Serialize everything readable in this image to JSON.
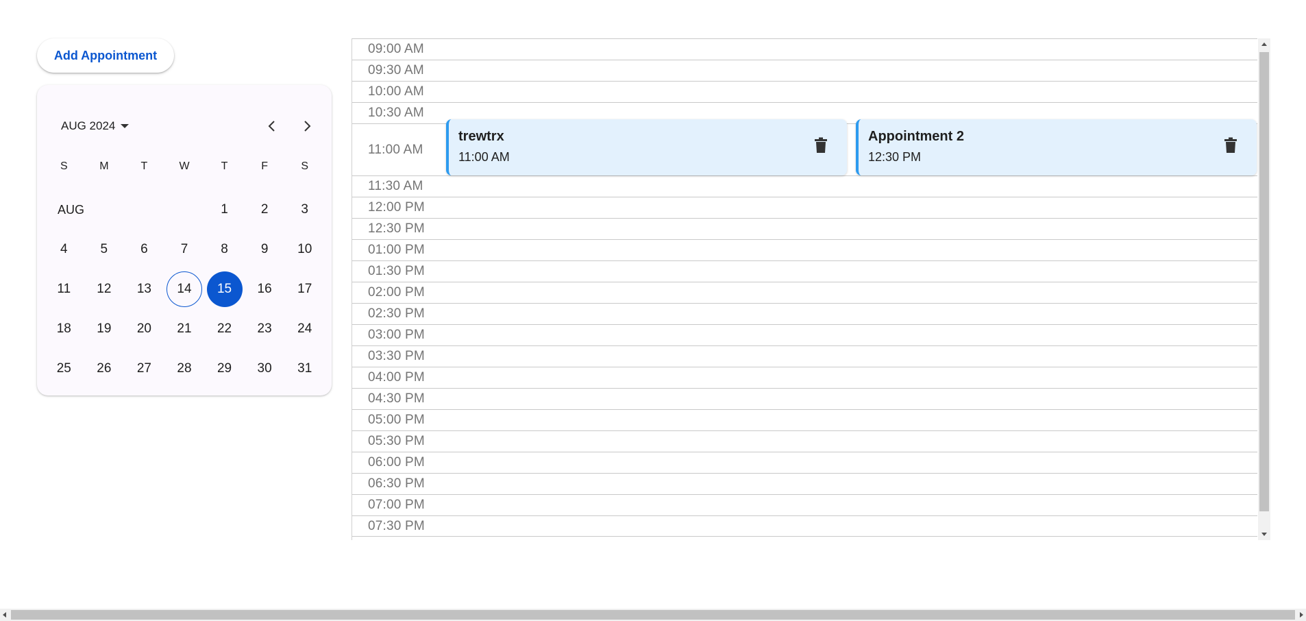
{
  "toolbar": {
    "add_label": "Add Appointment"
  },
  "calendar": {
    "month_label": "AUG 2024",
    "weekdays": [
      "S",
      "M",
      "T",
      "W",
      "T",
      "F",
      "S"
    ],
    "row_month_label": "AUG",
    "first_weekday_index": 4,
    "days_in_month": 31,
    "today": 14,
    "selected": 15,
    "icons": {
      "dropdown": "caret-down-icon",
      "prev": "chevron-left-icon",
      "next": "chevron-right-icon"
    }
  },
  "schedule": {
    "time_slots": [
      "09:00 AM",
      "09:30 AM",
      "10:00 AM",
      "10:30 AM",
      "11:00 AM",
      "11:30 AM",
      "12:00 PM",
      "12:30 PM",
      "01:00 PM",
      "01:30 PM",
      "02:00 PM",
      "02:30 PM",
      "03:00 PM",
      "03:30 PM",
      "04:00 PM",
      "04:30 PM",
      "05:00 PM",
      "05:30 PM",
      "06:00 PM",
      "06:30 PM",
      "07:00 PM",
      "07:30 PM"
    ],
    "expanded_slot": "11:00 AM",
    "appointments": [
      {
        "title": "trewtrx",
        "time": "11:00 AM",
        "delete_icon": "trash-icon"
      },
      {
        "title": "Appointment 2",
        "time": "12:30 PM",
        "delete_icon": "trash-icon"
      }
    ]
  },
  "colors": {
    "accent": "#0b57d0",
    "appointment_bg": "#e3f1fd",
    "appointment_border": "#2e9bef",
    "card_bg": "#fcf9fe"
  }
}
